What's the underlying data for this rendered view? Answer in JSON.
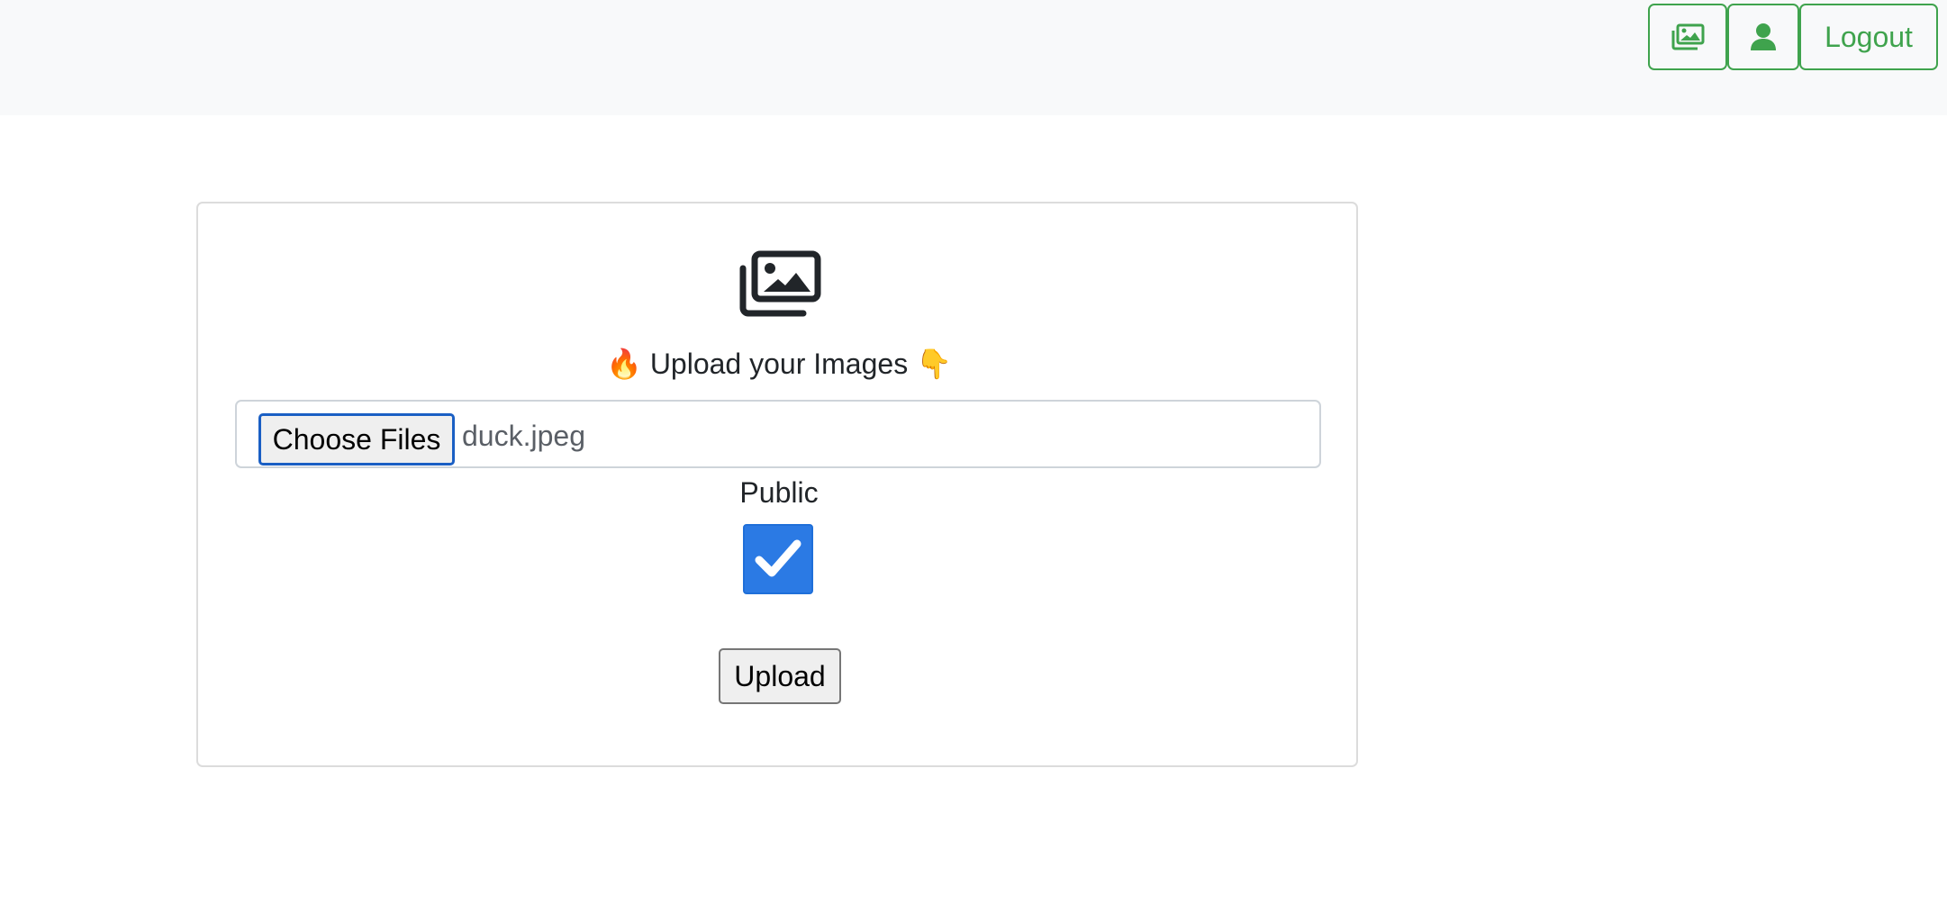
{
  "colors": {
    "nav_background": "#f8f9fa",
    "accent_green": "#3fa34d",
    "checkbox_blue": "#2b7ae4",
    "focus_blue": "#1a5fc4"
  },
  "navbar": {
    "gallery_button": {
      "icon": "images-icon"
    },
    "profile_button": {
      "icon": "user-icon"
    },
    "logout_label": "Logout"
  },
  "upload_card": {
    "hero_icon": "images-icon",
    "heading": "🔥 Upload your Images 👇",
    "file_input": {
      "button_label": "Choose Files",
      "file_name": "duck.jpeg"
    },
    "public_label": "Public",
    "public_checked": true,
    "upload_label": "Upload"
  }
}
